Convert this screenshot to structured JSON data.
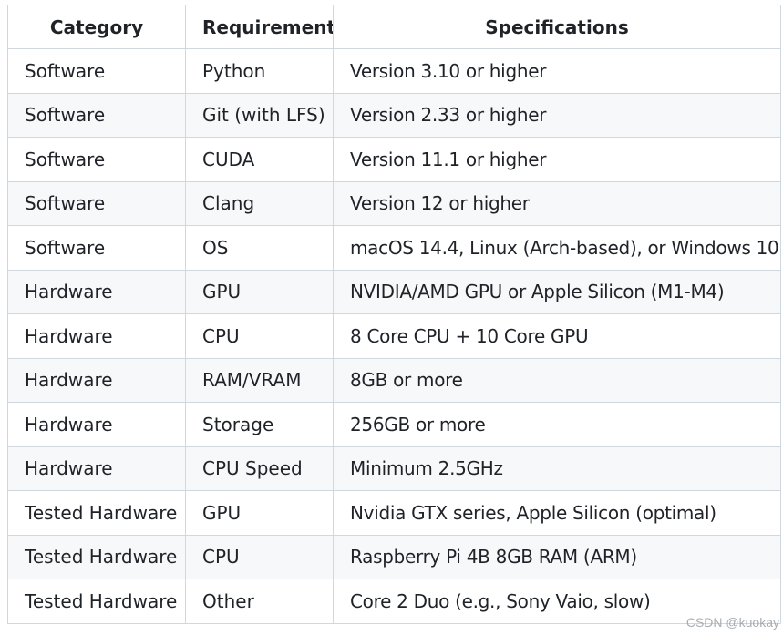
{
  "table": {
    "headers": [
      "Category",
      "Requirement",
      "Specifications"
    ],
    "rows": [
      [
        "Software",
        "Python",
        "Version 3.10 or higher"
      ],
      [
        "Software",
        "Git (with LFS)",
        "Version 2.33 or higher"
      ],
      [
        "Software",
        "CUDA",
        "Version 11.1 or higher"
      ],
      [
        "Software",
        "Clang",
        "Version 12 or higher"
      ],
      [
        "Software",
        "OS",
        "macOS 14.4, Linux (Arch-based), or Windows 10"
      ],
      [
        "Hardware",
        "GPU",
        "NVIDIA/AMD GPU or Apple Silicon (M1-M4)"
      ],
      [
        "Hardware",
        "CPU",
        "8 Core CPU + 10 Core GPU"
      ],
      [
        "Hardware",
        "RAM/VRAM",
        "8GB or more"
      ],
      [
        "Hardware",
        "Storage",
        "256GB or more"
      ],
      [
        "Hardware",
        "CPU Speed",
        "Minimum 2.5GHz"
      ],
      [
        "Tested Hardware",
        "GPU",
        "Nvidia GTX series, Apple Silicon (optimal)"
      ],
      [
        "Tested Hardware",
        "CPU",
        "Raspberry Pi 4B 8GB RAM (ARM)"
      ],
      [
        "Tested Hardware",
        "Other",
        "Core 2 Duo (e.g., Sony Vaio, slow)"
      ]
    ]
  },
  "watermark": "CSDN @kuokay"
}
